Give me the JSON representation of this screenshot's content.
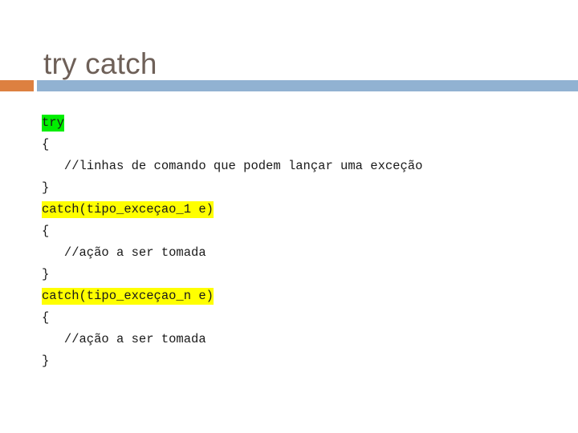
{
  "slide": {
    "title": "try catch",
    "title_color": "#6e6058",
    "background_color": "#ffffff",
    "rule": {
      "accent_color": "#dd8040",
      "main_color": "#91b2d2"
    }
  },
  "code": {
    "highlight_green": "#00ee00",
    "highlight_yellow": "#ffff00",
    "text_color": "#1a1a1a",
    "lines": [
      {
        "text": "try",
        "highlight": "green"
      },
      {
        "text": "{",
        "highlight": "none"
      },
      {
        "text": "   //linhas de comando que podem lançar uma exceção",
        "highlight": "none"
      },
      {
        "text": "}",
        "highlight": "none"
      },
      {
        "text": "catch(tipo_exceçao_1 e)",
        "highlight": "yellow"
      },
      {
        "text": "{",
        "highlight": "none"
      },
      {
        "text": "   //ação a ser tomada",
        "highlight": "none"
      },
      {
        "text": "}",
        "highlight": "none"
      },
      {
        "text": "catch(tipo_exceçao_n e)",
        "highlight": "yellow"
      },
      {
        "text": "{",
        "highlight": "none"
      },
      {
        "text": "   //ação a ser tomada",
        "highlight": "none"
      },
      {
        "text": "}",
        "highlight": "none"
      }
    ]
  }
}
